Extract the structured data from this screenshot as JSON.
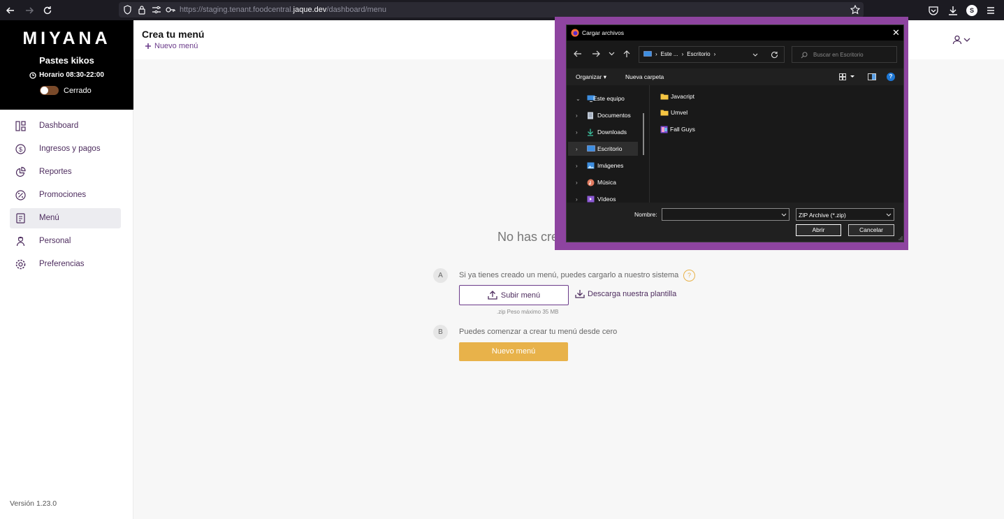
{
  "browser": {
    "url_prefix": "https://staging.tenant.foodcentral.",
    "url_domain": "jaque.dev",
    "url_path": "/dashboard/menu",
    "profile_initial": "S"
  },
  "brand": {
    "logo": "MIYANA",
    "name": "Pastes kikos",
    "hours": "Horario 08:30-22:00",
    "status": "Cerrado"
  },
  "nav": [
    {
      "label": "Dashboard",
      "icon": "dashboard-icon"
    },
    {
      "label": "Ingresos y pagos",
      "icon": "dollar-icon"
    },
    {
      "label": "Reportes",
      "icon": "pie-chart-icon"
    },
    {
      "label": "Promociones",
      "icon": "percent-icon"
    },
    {
      "label": "Menú",
      "icon": "menu-doc-icon"
    },
    {
      "label": "Personal",
      "icon": "person-icon"
    },
    {
      "label": "Preferencias",
      "icon": "gear-icon"
    }
  ],
  "version": "Versión 1.23.0",
  "header": {
    "title": "Crea tu menú",
    "new_menu_link": "Nuevo menú"
  },
  "empty": {
    "title": "No has crea",
    "step_a_badge": "A",
    "step_a_text": "Si ya tienes creado un menú, puedes cargarlo a nuestro sistema",
    "help": "?",
    "upload_button": "Subir menú",
    "download_link": "Descarga nuestra plantilla",
    "size_note": ".zip Peso máximo 35 MB",
    "step_b_badge": "B",
    "step_b_text": "Puedes comenzar a crear tu menú desde cero",
    "create_button": "Nuevo menú"
  },
  "dialog": {
    "title": "Cargar archivos",
    "close": "✕",
    "breadcrumb_root": "Este ...",
    "breadcrumb_current": "Escritorio",
    "search_placeholder": "Buscar en Escritorio",
    "organize": "Organizar",
    "new_folder": "Nueva carpeta",
    "help": "?",
    "tree": [
      {
        "label": "Este equipo",
        "icon": "computer-icon"
      },
      {
        "label": "Documentos",
        "icon": "documents-icon"
      },
      {
        "label": "Downloads",
        "icon": "download-arrow-icon"
      },
      {
        "label": "Escritorio",
        "icon": "desktop-icon"
      },
      {
        "label": "Imágenes",
        "icon": "pictures-icon"
      },
      {
        "label": "Música",
        "icon": "music-icon"
      },
      {
        "label": "Vídeos",
        "icon": "videos-icon"
      }
    ],
    "files": [
      {
        "name": "Javacript",
        "icon": "folder-icon"
      },
      {
        "name": "Umvel",
        "icon": "folder-icon"
      },
      {
        "name": "Fall Guys",
        "icon": "app-shortcut-icon"
      }
    ],
    "name_label": "Nombre:",
    "name_value": "",
    "filetype": "ZIP Archive (*.zip)",
    "open_button": "Abrir",
    "cancel_button": "Cancelar"
  },
  "colors": {
    "brand_purple": "#6b3b8a",
    "accent_gold": "#e8b24a",
    "dialog_highlight": "#8e44a0"
  }
}
